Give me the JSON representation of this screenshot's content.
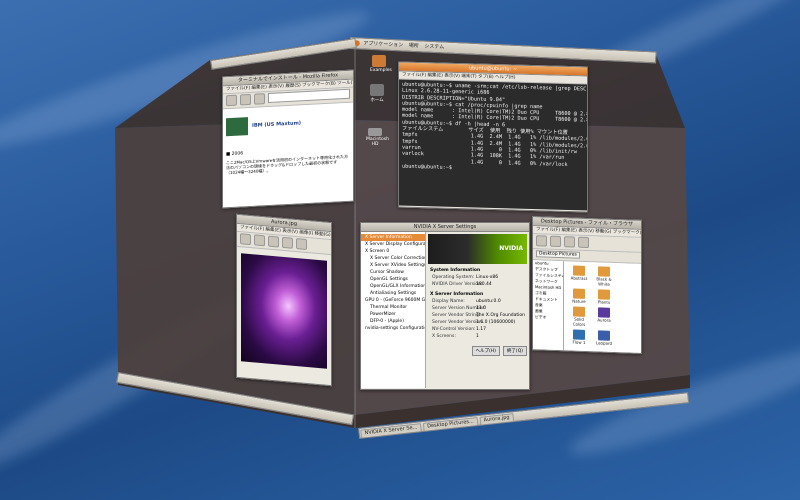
{
  "desktop": {
    "top_panel": {
      "menu_apps": "アプリケーション",
      "menu_places": "場所",
      "menu_system": "システム"
    },
    "icons": [
      {
        "label": "Examples"
      },
      {
        "label": "ホーム"
      },
      {
        "label": "Macintosh HD"
      }
    ]
  },
  "terminal": {
    "title": "ubuntu@ubuntu: ~",
    "menu": "ファイル(F)  編集(E)  表示(V)  端末(T)  タブ(B)  ヘルプ(H)",
    "lines": [
      "ubuntu@ubuntu:~$ uname -srm;cat /etc/lsb-release |grep DESC",
      "Linux 2.6.28-11-generic i686",
      "DISTRIB_DESCRIPTION=\"Ubuntu 9.04\"",
      "ubuntu@ubuntu:~$ cat /proc/cpuinfo |grep name",
      "model name      : Intel(R) Core(TM)2 Duo CPU     T8600 @ 2.80GHz",
      "model name      : Intel(R) Core(TM)2 Duo CPU     T8600 @ 2.80GHz",
      "ubuntu@ubuntu:~$ df -h |head -n 6",
      "ファイルシステム        サイズ  使用  残り 使用% マウント位置",
      "tmpfs                 1.4G  2.4M  1.4G   1% /lib/modules/2.6.28-11-generic/volatile",
      "tmpfs                 1.4G  2.4M  1.4G   1% /lib/modules/2.6.28-11-generic/volatile",
      "varrun                1.4G     0  1.4G   0% /lib/init/rw",
      "varlock               1.4G  108K  1.4G   1% /var/run",
      "                      1.4G     0  1.4G   0% /var/lock",
      "ubuntu@ubuntu:~$ "
    ]
  },
  "firefox": {
    "title": "ターミナルでインストール - Mozilla Firefox",
    "menu": "ファイル(F) 編集(E) 表示(V) 履歴(S) ブックマーク(B) ツール(T) ヘルプ(H)",
    "brand": "IBM (US Maxtum)",
    "section": "■ 2006",
    "text": "ここ2Mac/OS上Vmwareを活用初のインターネット専用化された方法のパソコンの環境をドラッグ&ドロップした最初の状態です（1024幅〜3240幅）。"
  },
  "eog": {
    "title": "Aurora.jpg",
    "menu": "ファイル(F) 編集(E) 表示(V) 画像(I) 移動(G) ヘルプ(H)"
  },
  "nvidia": {
    "title": "NVIDIA X Server Settings",
    "tree": [
      "X Server Information",
      "X Server Display Configuration",
      "X Screen 0",
      "X Server Color Correction",
      "X Server XVideo Settings",
      "Cursor Shadow",
      "OpenGL Settings",
      "OpenGL/GLX Information",
      "Antialiasing Settings",
      "GPU 0 - (GeForce 9600M GT)",
      "Thermal Monitor",
      "PowerMizer",
      "DFP-0 - (Apple)",
      "nvidia-settings Configuration"
    ],
    "banner": "NVIDIA",
    "section1": "System Information",
    "info": [
      {
        "k": "Operating System:",
        "v": "Linux-x86"
      },
      {
        "k": "NVIDIA Driver Version:",
        "v": "180.44"
      }
    ],
    "section2": "X Server Information",
    "info2": [
      {
        "k": "Display Name:",
        "v": "ubuntu:0.0"
      },
      {
        "k": "Server Version Number:",
        "v": "11.0"
      },
      {
        "k": "Server Vendor String:",
        "v": "The X.Org Foundation"
      },
      {
        "k": "Server Vendor Version:",
        "v": "1.6.0 (10600000)"
      },
      {
        "k": "NV-Control Version:",
        "v": "1.17"
      },
      {
        "k": "X Screens:",
        "v": "1"
      }
    ],
    "help_btn": "ヘルプ(H)",
    "quit_btn": "終了(Q)"
  },
  "nautilus": {
    "title": "Desktop Pictures - ファイル・ブラウザ",
    "menu": "ファイル(F) 編集(E) 表示(V) 移動(G) ブックマーク(B) ヘルプ(H)",
    "location": "Desktop Pictures",
    "places": [
      "ubuntu",
      "デスクトップ",
      "ファイルシステム",
      "ネットワーク",
      "Macintosh HD",
      "ゴミ箱",
      "ドキュメント",
      "音楽",
      "画像",
      "ビデオ"
    ],
    "folders": [
      "Abstract",
      "Black & White",
      "Nature",
      "Plants",
      "Solid Colors",
      "Aurora",
      "Flow 1",
      "Leopard"
    ]
  },
  "bottom_panel": {
    "tasks": [
      "NVIDIA X Server Se...",
      "Desktop Pictures...",
      "Aurora.jpg"
    ]
  },
  "colors": {
    "accent": "#e48c3a",
    "nvidia_green": "#76b900",
    "desktop_blue": "#2a5c9e"
  }
}
